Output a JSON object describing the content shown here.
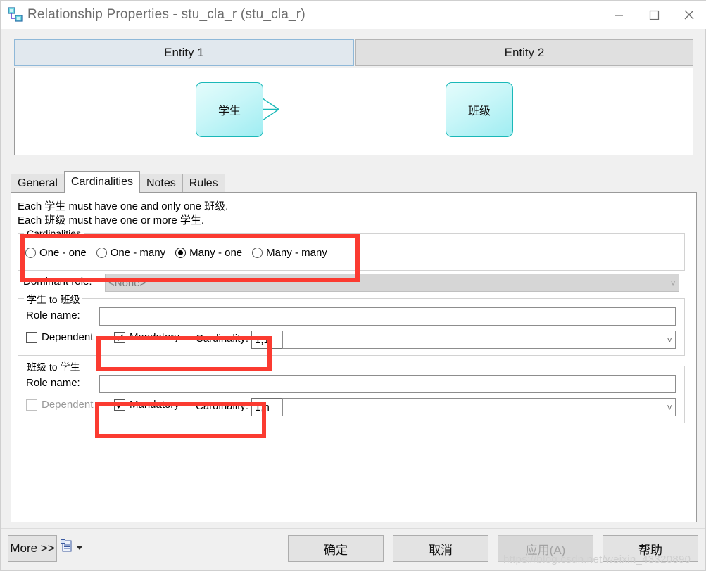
{
  "window": {
    "title": "Relationship Properties - stu_cla_r (stu_cla_r)",
    "icon": "relationship-icon",
    "minimize_label": "—",
    "maximize_label": "□",
    "close_label": "✕"
  },
  "entity_panels": [
    {
      "label": "Entity 1",
      "selected": true
    },
    {
      "label": "Entity 2",
      "selected": false
    }
  ],
  "diagram": {
    "left_entity": "学生",
    "right_entity": "班级",
    "entity_fill": "#c8f6f8",
    "entity_border": "#1ab8b8",
    "connector": "crows-foot-to-one"
  },
  "tabs": [
    {
      "label": "General",
      "active": false
    },
    {
      "label": "Cardinalities",
      "active": true
    },
    {
      "label": "Notes",
      "active": false
    },
    {
      "label": "Rules",
      "active": false
    }
  ],
  "cardinalities_page": {
    "description_line1": "Each 学生 must have one and only one 班级.",
    "description_line2": "Each 班级 must have one or more 学生.",
    "cardinalities_group": {
      "legend": "Cardinalities",
      "options": [
        {
          "label": "One - one",
          "selected": false
        },
        {
          "label": "One - many",
          "selected": false
        },
        {
          "label": "Many - one",
          "selected": true
        },
        {
          "label": "Many - many",
          "selected": false
        }
      ]
    },
    "dominant_role": {
      "label": "Dominant role:",
      "value": "<None>",
      "disabled": true
    },
    "role_groups": [
      {
        "legend": "学生 to 班级",
        "role_name_label": "Role name:",
        "role_name_value": "",
        "dependent_label": "Dependent",
        "dependent_checked": false,
        "dependent_disabled": false,
        "mandatory_label": "Mandatory",
        "mandatory_checked": true,
        "cardinality_label": "Cardinality:",
        "cardinality_value": "1,1",
        "cardinality_combo_value": ""
      },
      {
        "legend": "班级 to 学生",
        "role_name_label": "Role name:",
        "role_name_value": "",
        "dependent_label": "Dependent",
        "dependent_checked": false,
        "dependent_disabled": true,
        "mandatory_label": "Mandatory",
        "mandatory_checked": true,
        "cardinality_label": "Cardinality:",
        "cardinality_value": "1,n",
        "cardinality_combo_value": ""
      }
    ]
  },
  "annotations": {
    "color": "#fb3b31",
    "boxes": [
      "cardinalities-group",
      "first-mandatory-cardinality",
      "second-mandatory-cardinality"
    ]
  },
  "footer": {
    "more_button": "More >>",
    "report_icon": "report-icon",
    "ok_button": "确定",
    "cancel_button": "取消",
    "apply_button": "应用(A)",
    "apply_disabled": true,
    "help_button": "帮助"
  },
  "watermark": "https://blog.csdn.net/weixin_43320890"
}
